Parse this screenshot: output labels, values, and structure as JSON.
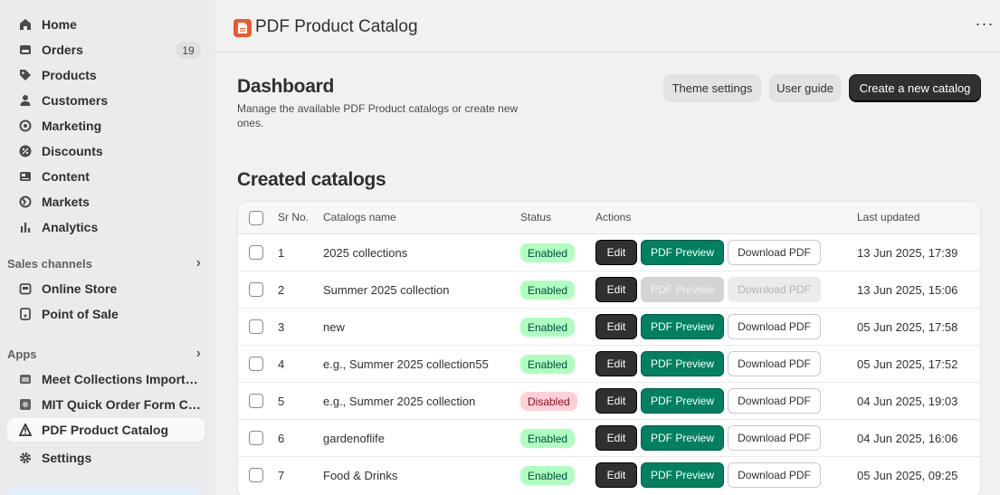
{
  "sidebar": {
    "items": [
      {
        "label": "Home",
        "icon": "home-icon",
        "badge": ""
      },
      {
        "label": "Orders",
        "icon": "orders-icon",
        "badge": "19"
      },
      {
        "label": "Products",
        "icon": "tag-icon",
        "badge": ""
      },
      {
        "label": "Customers",
        "icon": "person-icon",
        "badge": ""
      },
      {
        "label": "Marketing",
        "icon": "target-icon",
        "badge": ""
      },
      {
        "label": "Discounts",
        "icon": "discount-icon",
        "badge": ""
      },
      {
        "label": "Content",
        "icon": "content-icon",
        "badge": ""
      },
      {
        "label": "Markets",
        "icon": "globe-icon",
        "badge": ""
      },
      {
        "label": "Analytics",
        "icon": "bar-chart-icon",
        "badge": ""
      }
    ],
    "sales_channels_title": "Sales channels",
    "sales_channels": [
      {
        "label": "Online Store",
        "icon": "store-icon"
      },
      {
        "label": "Point of Sale",
        "icon": "pos-icon"
      }
    ],
    "apps_title": "Apps",
    "apps": [
      {
        "label": "Meet Collections Import E...",
        "icon": "app-icon"
      },
      {
        "label": "MIT Quick Order Form COD",
        "icon": "app-icon"
      },
      {
        "label": "PDF Product Catalog",
        "icon": "triangle-app-icon"
      }
    ],
    "settings_label": "Settings"
  },
  "topbar": {
    "app_title": "PDF Product Catalog",
    "more_label": "···"
  },
  "header": {
    "title": "Dashboard",
    "subtitle": "Manage the available PDF Product catalogs or create new ones.",
    "theme_settings": "Theme settings",
    "user_guide": "User guide",
    "create_catalog": "Create a new catalog"
  },
  "catalogs": {
    "title": "Created catalogs",
    "columns": {
      "sr": "Sr No.",
      "name": "Catalogs name",
      "status": "Status",
      "actions": "Actions",
      "updated": "Last updated"
    },
    "edit_label": "Edit",
    "preview_label": "PDF Preview",
    "download_label": "Download PDF",
    "rows": [
      {
        "sr": "1",
        "name": "2025 collections",
        "status": "Enabled",
        "updated": "13 Jun 2025, 17:39"
      },
      {
        "sr": "2",
        "name": "Summer 2025 collection",
        "status": "Enabled",
        "updated": "13 Jun 2025, 15:06"
      },
      {
        "sr": "3",
        "name": "new",
        "status": "Enabled",
        "updated": "05 Jun 2025, 17:58"
      },
      {
        "sr": "4",
        "name": "e.g., Summer 2025 collection55",
        "status": "Enabled",
        "updated": "05 Jun 2025, 17:52"
      },
      {
        "sr": "5",
        "name": "e.g., Summer 2025 collection",
        "status": "Disabled",
        "updated": "04 Jun 2025, 19:03"
      },
      {
        "sr": "6",
        "name": "gardenoflife",
        "status": "Enabled",
        "updated": "04 Jun 2025, 16:06"
      },
      {
        "sr": "7",
        "name": "Food & Drinks",
        "status": "Enabled",
        "updated": "05 Jun 2025, 09:25"
      }
    ]
  },
  "colors": {
    "primary_green": "#008060",
    "dark_button": "#303030",
    "enabled_badge": "#affebf",
    "disabled_badge": "#fed1d7"
  }
}
